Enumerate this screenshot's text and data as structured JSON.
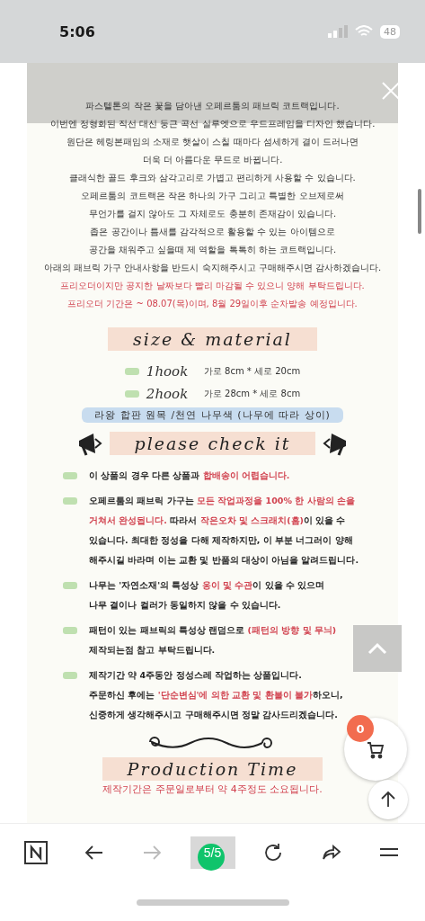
{
  "status_bar": {
    "time": "5:06",
    "battery": "48"
  },
  "detail_image": {
    "intro": [
      {
        "kind": "plain",
        "text": "파스텔톤의 작은 꽃을 담아낸 오페르툼의 패브릭 코트랙입니다."
      },
      {
        "kind": "plain",
        "text": "이번엔 정형화된 직선 대신 둥근 곡선 실루엣으로 우드프레임을 디자인 했습니다."
      },
      {
        "kind": "plain",
        "text": "원단은 헤링본패임의 소재로 햇살이 스칠 때마다 섬세하게 결이 드러나면"
      },
      {
        "kind": "plain",
        "text": "더욱 더 아름다운 무드로 바뀝니다."
      },
      {
        "kind": "plain",
        "text": "클래식한 골드 후크와 삼각고리로 가볍고 편리하게 사용할 수 있습니다."
      },
      {
        "kind": "plain",
        "text": "오페르툼의 코트랙은 작은 하나의 가구 그리고 특별한 오브제로써"
      },
      {
        "kind": "plain",
        "text": "무언가를 걸지 않아도 그 자체로도 충분히 존재감이 있습니다."
      },
      {
        "kind": "plain",
        "text": "좁은 공간이나 틈새를 감각적으로 활용할 수 있는 아이템으로"
      },
      {
        "kind": "plain",
        "text": "공간을 채워주고 싶을때 제 역할을 톡톡히 하는 코트랙입니다."
      },
      {
        "kind": "plain",
        "text": "아래의 패브릭 가구 안내사항을 반드시 숙지해주시고 구매해주시면 감사하겠습니다."
      },
      {
        "kind": "notice",
        "text": "프리오더이지만 공지한 날짜보다 빨리 마감될 수 있으니 양해 부탁드립니다."
      },
      {
        "kind": "notice",
        "text": "프리오더 기간은 ~ 08.07(목)이며, 8월 29일이후 순차발송 예정입니다."
      }
    ],
    "size_heading": "size & material",
    "sizes": [
      {
        "name": "1hook",
        "dims": "가로 8cm * 세로 20cm"
      },
      {
        "name": "2hook",
        "dims": "가로 28cm * 세로 8cm"
      }
    ],
    "material": "라왕 합판 원목 /천연 나무색 (나무에 따라 상이)",
    "check_heading": "please check it",
    "notes": [
      "이 상품의 경우 다른 상품과 **합배송이 어렵습니다.**",
      "오페르툼의 패브릭 가구는 **모든 작업과정을 100% 한 사람의 손을\n거쳐서 완성됩니다.** 따라서 **작은오차 및 스크래치(흠)**이 있을 수\n있습니다. 최대한 정성을 다해 제작하지만, 이 부분 너그러이 양해\n해주시길 바라며 이는 교환 및 반품의 대상이 아님을 알려드립니다.",
      "나무는 '자연소재'의 특성상 **옹이 및 수관**이 있을 수 있으며\n나무 결이나 컬러가 동일하지 않을 수 있습니다.",
      "패턴이 있는 패브릭의 특성상 랜덤으로 **(패턴의 방향 및 무늬)**\n제작되는점 참고 부탁드립니다.",
      "제작기간 약 4주동안 정성스레 작업하는 상품입니다.\n주문하신 후에는 **'단순변심'에 의한 교환 및 환불이 불가**하오니,\n신중하게 생각해주시고 구매해주시면 정말 감사드리겠습니다."
    ],
    "production_heading": "Production Time",
    "production_note": "제작기간은 주문일로부터 약 4주정도 소요됩니다."
  },
  "cart": {
    "count": "0"
  },
  "toolbar": {
    "forward": {
      "disabled": true
    },
    "tab_count": "5/5"
  }
}
